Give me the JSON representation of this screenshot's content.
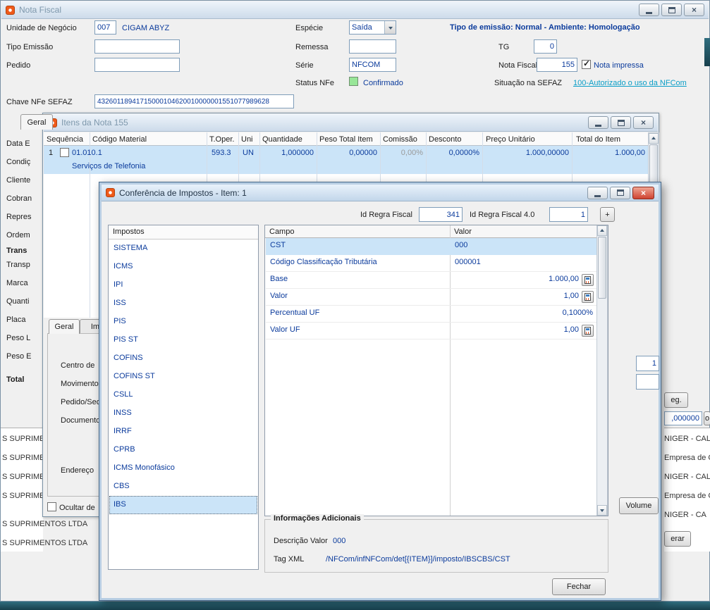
{
  "glyphs": {
    "close": "×",
    "plus": "+",
    "scroll_up": "▲",
    "scroll_down": "▼"
  },
  "nota_fiscal": {
    "title": "Nota Fiscal",
    "fields": {
      "unidade_label": "Unidade de Negócio",
      "unidade_codigo": "007",
      "unidade_nome": "CIGAM ABYZ",
      "especie_label": "Espécie",
      "especie_valor": "Saída",
      "emissao_banner": "Tipo de emissão: Normal - Ambiente: Homologação",
      "tipo_emissao_label": "Tipo Emissão",
      "remessa_label": "Remessa",
      "tg_label": "TG",
      "tg_valor": "0",
      "pedido_label": "Pedido",
      "serie_label": "Série",
      "serie_valor": "NFCOM",
      "nota_fiscal_label": "Nota Fiscal",
      "nota_fiscal_valor": "155",
      "nota_impressa_label": "Nota impressa",
      "status_label": "Status NFe",
      "status_valor": "Confirmado",
      "situacao_label": "Situação na SEFAZ",
      "situacao_link": "100-Autorizado o uso da NFCom",
      "chave_label": "Chave NFe SEFAZ",
      "chave_valor": "43260118941715000104620010000001551077989628"
    },
    "tab_geral": "Geral",
    "left_labels": [
      "Data E",
      "Condiç",
      "Cliente",
      "Cobran",
      "Repres",
      "Ordem",
      "Trans",
      "Transp",
      "Marca",
      "Quanti",
      "Placa",
      "Peso L",
      "Peso E",
      "Total"
    ],
    "bottom_rows": [
      "S SUPRIME",
      "S SUPRIME",
      "S SUPRIME",
      "S SUPRIME",
      "S SUPRIMENTOS LTDA",
      "S SUPRIMENTOS LTDA"
    ],
    "right_rows": [
      "NIGER - CAL",
      "Empresa de Ce",
      "NIGER - CAL",
      "Empresa de Co",
      "NIGER - CA"
    ],
    "fragments": {
      "btn_eg": "eg.",
      "valor_000000": ",000000",
      "btn_o": "o",
      "btn_erar": "erar"
    }
  },
  "itens": {
    "title": "Itens da Nota 155",
    "columns": [
      "Sequência",
      "Código Material",
      "T.Oper.",
      "Uni",
      "Quantidade",
      "Peso Total Item",
      "Comissão",
      "Desconto",
      "Preço Unitário",
      "Total do Item"
    ],
    "row": {
      "sequencia": "1",
      "codigo": "01.010.1",
      "descricao": "Serviços de Telefonia",
      "t_oper": "593.3",
      "uni": "UN",
      "quantidade": "1,000000",
      "peso_total": "0,00000",
      "comissao": "0,00%",
      "desconto": "0,0000%",
      "preco_unitario": "1.000,00000",
      "total_item": "1.000,00"
    },
    "tab_geral": "Geral",
    "tab_impostos": "Imp",
    "form_labels": [
      "Centro de",
      "Movimento",
      "Pedido/Seq",
      "Documento",
      "Endereço"
    ],
    "ocultar_label": "Ocultar de",
    "side_value": "1",
    "volume_button": "Volume"
  },
  "conferencia": {
    "title": "Conferência de Impostos - Item: 1",
    "id_regra_label": "Id Regra Fiscal",
    "id_regra_valor": "341",
    "id_regra4_label": "Id Regra Fiscal 4.0",
    "id_regra4_valor": "1",
    "impostos_header": "Impostos",
    "impostos": [
      "SISTEMA",
      "ICMS",
      "IPI",
      "ISS",
      "PIS",
      "PIS ST",
      "COFINS",
      "COFINS ST",
      "CSLL",
      "INSS",
      "IRRF",
      "CPRB",
      "ICMS Monofásico",
      "CBS",
      "IBS"
    ],
    "selected_imposto": "IBS",
    "grid": {
      "col_campo": "Campo",
      "col_valor": "Valor",
      "rows": [
        {
          "campo": "CST",
          "valor": "000"
        },
        {
          "campo": "Código Classificação Tributária",
          "valor": "000001"
        },
        {
          "campo": "Base",
          "valor": "1.000,00"
        },
        {
          "campo": "Valor",
          "valor": "1,00"
        },
        {
          "campo": "Percentual UF",
          "valor": "0,1000%"
        },
        {
          "campo": "Valor UF",
          "valor": "1,00"
        }
      ]
    },
    "info": {
      "titulo": "Informações Adicionais",
      "descricao_label": "Descrição Valor",
      "descricao_valor": "000",
      "tag_label": "Tag XML",
      "tag_valor": "/NFCom/infNFCom/det[{ITEM}]/imposto/IBSCBS/CST"
    },
    "fechar_button": "Fechar"
  }
}
